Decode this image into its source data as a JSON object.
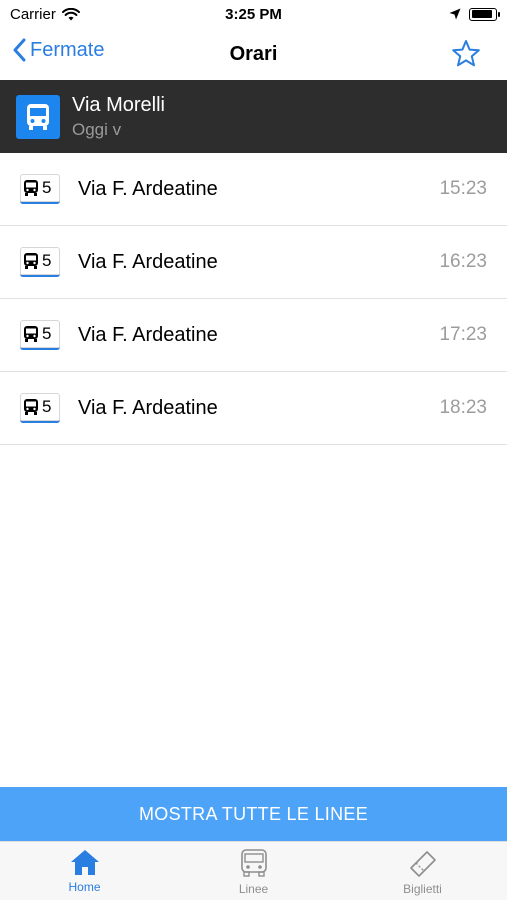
{
  "status_bar": {
    "carrier": "Carrier",
    "time": "3:25 PM",
    "battery_level": 0.9
  },
  "nav": {
    "back_label": "Fermate",
    "title": "Orari"
  },
  "stop": {
    "name": "Via Morelli",
    "day_selector": "Oggi v"
  },
  "schedule": [
    {
      "line": "5",
      "destination": "Via F. Ardeatine",
      "time": "15:23"
    },
    {
      "line": "5",
      "destination": "Via F. Ardeatine",
      "time": "16:23"
    },
    {
      "line": "5",
      "destination": "Via F. Ardeatine",
      "time": "17:23"
    },
    {
      "line": "5",
      "destination": "Via F. Ardeatine",
      "time": "18:23"
    }
  ],
  "show_all_button": "MOSTRA TUTTE LE LINEE",
  "tabs": [
    {
      "label": "Home",
      "icon": "home-icon"
    },
    {
      "label": "Linee",
      "icon": "bus-icon"
    },
    {
      "label": "Biglietti",
      "icon": "ticket-icon"
    }
  ],
  "colors": {
    "accent": "#2a7de1",
    "header_bg": "#2d2d2d",
    "stop_icon_bg": "#1c86ee",
    "button_bg": "#4da3f7"
  }
}
